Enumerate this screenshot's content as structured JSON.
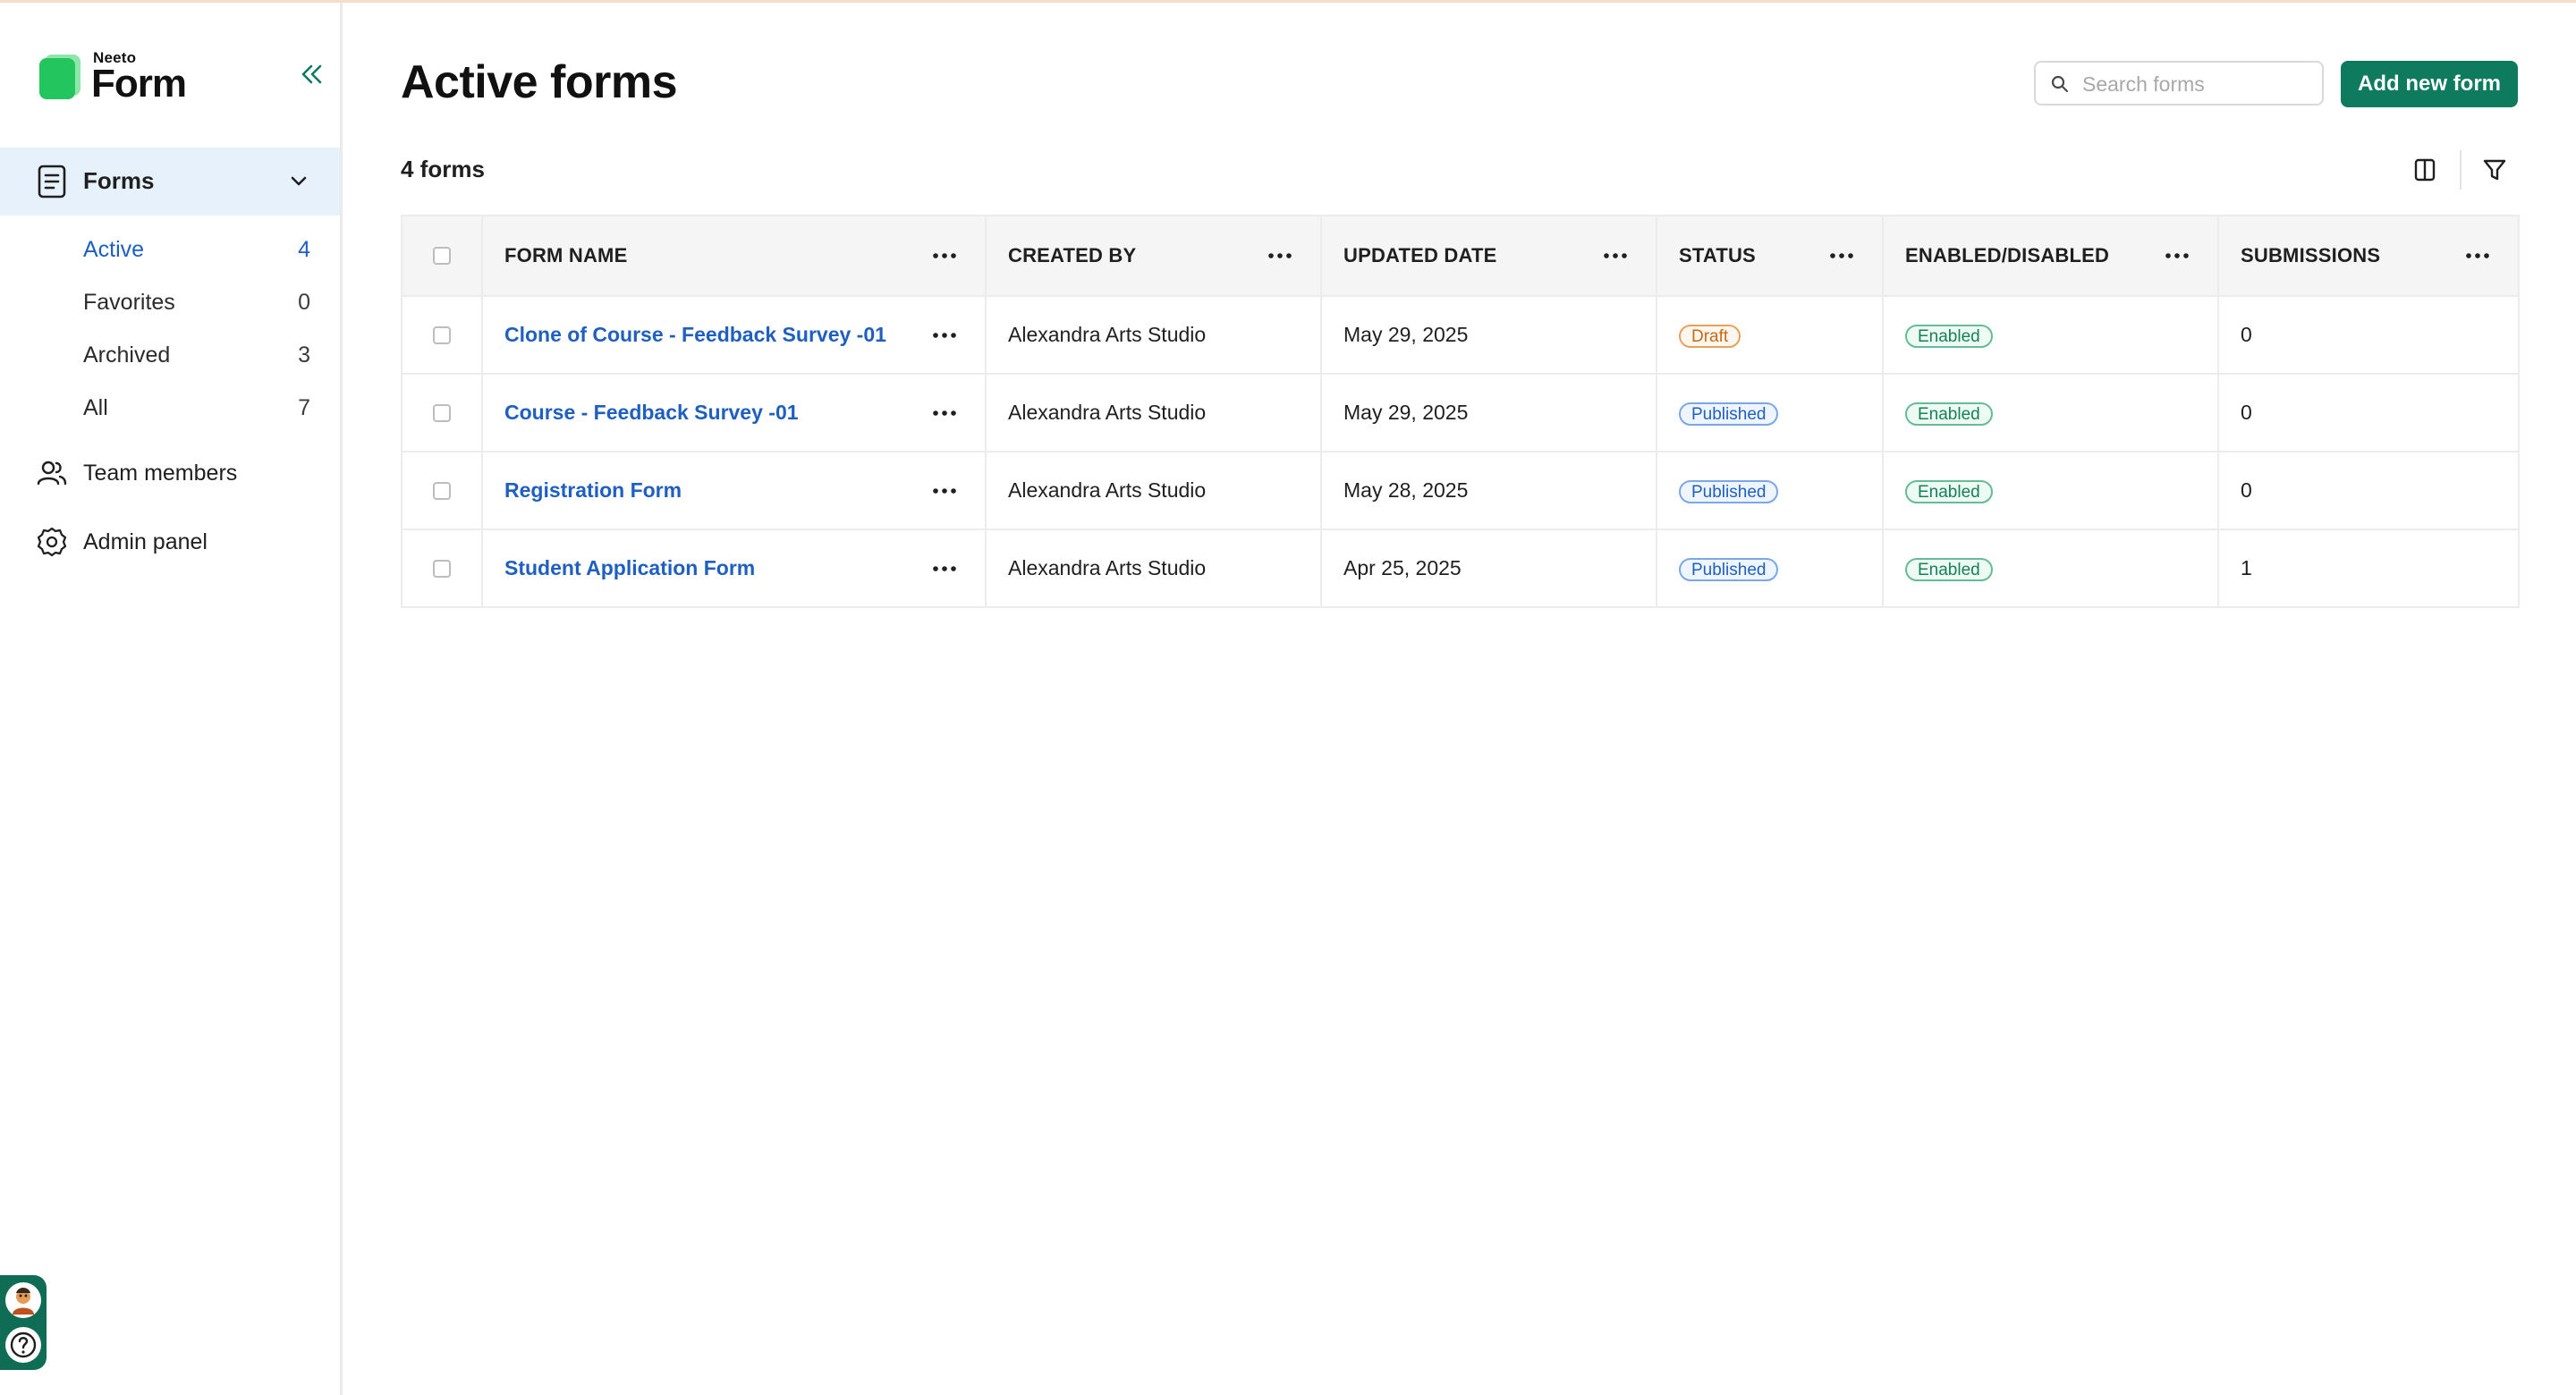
{
  "app": {
    "brand_small": "Neeto",
    "brand_big": "Form"
  },
  "sidebar": {
    "forms_label": "Forms",
    "sub_items": [
      {
        "label": "Active",
        "count": "4"
      },
      {
        "label": "Favorites",
        "count": "0"
      },
      {
        "label": "Archived",
        "count": "3"
      },
      {
        "label": "All",
        "count": "7"
      }
    ],
    "team_members_label": "Team members",
    "admin_panel_label": "Admin panel"
  },
  "header": {
    "title": "Active forms",
    "search_placeholder": "Search forms",
    "add_button_label": "Add new form",
    "count_label": "4 forms"
  },
  "table": {
    "columns": [
      "FORM NAME",
      "CREATED BY",
      "UPDATED DATE",
      "STATUS",
      "ENABLED/DISABLED",
      "SUBMISSIONS"
    ],
    "rows": [
      {
        "name": "Clone of Course - Feedback Survey -01",
        "created_by": "Alexandra Arts Studio",
        "updated": "May 29, 2025",
        "status": "Draft",
        "enabled": "Enabled",
        "submissions": "0"
      },
      {
        "name": "Course - Feedback Survey -01",
        "created_by": "Alexandra Arts Studio",
        "updated": "May 29, 2025",
        "status": "Published",
        "enabled": "Enabled",
        "submissions": "0"
      },
      {
        "name": "Registration Form",
        "created_by": "Alexandra Arts Studio",
        "updated": "May 28, 2025",
        "status": "Published",
        "enabled": "Enabled",
        "submissions": "0"
      },
      {
        "name": "Student Application Form",
        "created_by": "Alexandra Arts Studio",
        "updated": "Apr 25, 2025",
        "status": "Published",
        "enabled": "Enabled",
        "submissions": "1"
      }
    ]
  },
  "colors": {
    "accent": "#0e7a5e",
    "link": "#1f5fc2",
    "active_nav_bg": "#e7f1fc"
  }
}
